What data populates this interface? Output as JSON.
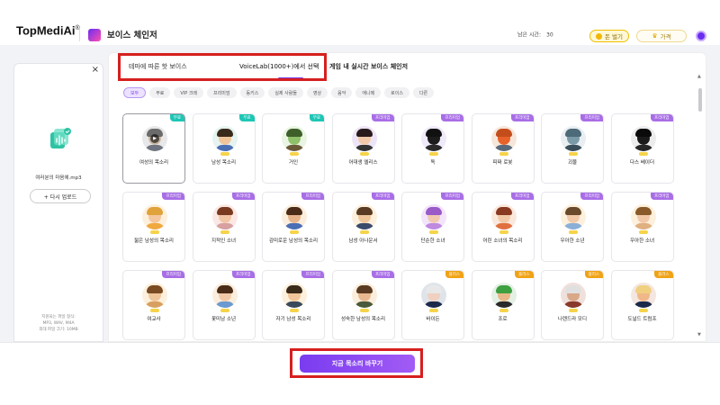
{
  "header": {
    "logo": "TopMediAi",
    "logo_mark": "®",
    "tool_title": "보이스 체인저",
    "remaining_label": "남은 시간:",
    "remaining_value": "30",
    "earn_label": "돈 벌기",
    "price_label": "가격"
  },
  "left_panel": {
    "close": "×",
    "file_name": "여러분의 마음에.mp3",
    "reupload_label": "+ 다시 업로드",
    "note_lines": [
      "지원되는 파일 형식:",
      "MP3, WAV, M4A",
      "최대 파일 크기: 10MB"
    ]
  },
  "tabs": [
    {
      "label": "테마에 따른 핫 보이스"
    },
    {
      "label": "VoiceLab(1000+)에서 선택"
    },
    {
      "label": "게임 내 실시간 보이스 체인저"
    }
  ],
  "filters": [
    "모두",
    "무료",
    "VIP 크레",
    "프리미엄",
    "동키스",
    "실제 사람들",
    "영상",
    "음악",
    "애니메",
    "로이스",
    "다른"
  ],
  "cards": [
    {
      "label": "여성의 목소리",
      "badge": "무료",
      "badge_type": "free",
      "skin": "#c9b7a4",
      "hair": "#6b6b6b",
      "shirt": "#6f7480",
      "bg": "#e8e8ea"
    },
    {
      "label": "남성 목소리",
      "badge": "무료",
      "badge_type": "free",
      "skin": "#f0c59a",
      "hair": "#3a2a1c",
      "shirt": "#4a6fb5",
      "bg": "#e6f3f0"
    },
    {
      "label": "거인",
      "badge": "무료",
      "badge_type": "free",
      "skin": "#8fc06a",
      "hair": "#3f5f2a",
      "shirt": "#6b5a3a",
      "bg": "#e9f5e2"
    },
    {
      "label": "어대생 엘리스",
      "badge": "프리미엄",
      "badge_type": "premium",
      "skin": "#f2c8a8",
      "hair": "#2a1a1a",
      "shirt": "#333",
      "bg": "#eee4f7"
    },
    {
      "label": "독",
      "badge": "프리미엄",
      "badge_type": "premium",
      "skin": "#1c1c1c",
      "hair": "#111",
      "shirt": "#2a2a2a",
      "bg": "#f0e9f9"
    },
    {
      "label": "피짜 로봇",
      "badge": "프리미엄",
      "badge_type": "premium",
      "skin": "#e8622a",
      "hair": "#c44d1c",
      "shirt": "#5a6a7a",
      "bg": "#f6e6da"
    },
    {
      "label": "괴물",
      "badge": "프리미엄",
      "badge_type": "premium",
      "skin": "#7a9aa8",
      "hair": "#4c6a78",
      "shirt": "#3b4f5a",
      "bg": "#e8eef2"
    },
    {
      "label": "다스 베이더",
      "badge": "프리미엄",
      "badge_type": "premium",
      "skin": "#1a1a1a",
      "hair": "#0a0a0a",
      "shirt": "#262626",
      "bg": "#ececec"
    },
    {
      "label": "젊은 남성의 목소리",
      "badge": "프리미엄",
      "badge_type": "premium",
      "skin": "#f4c79f",
      "hair": "#e0a23a",
      "shirt": "#f0a840",
      "bg": "#fdf0dc"
    },
    {
      "label": "지적인 소녀",
      "badge": "프리미엄",
      "badge_type": "premium",
      "skin": "#f2c5a5",
      "hair": "#7a3a20",
      "shirt": "#d8a0a0",
      "bg": "#fbe8e4"
    },
    {
      "label": "감미로운 남성의 목소리",
      "badge": "프리미엄",
      "badge_type": "premium",
      "skin": "#e7b48c",
      "hair": "#4a2c18",
      "shirt": "#4a6fb5",
      "bg": "#fbeedd"
    },
    {
      "label": "남성 아나운서",
      "badge": "프리미엄",
      "badge_type": "premium",
      "skin": "#f0c59a",
      "hair": "#5a3a22",
      "shirt": "#3a4a6a",
      "bg": "#fdf0dc"
    },
    {
      "label": "단순한 소녀",
      "badge": "프리미엄",
      "badge_type": "premium",
      "skin": "#f2c9b0",
      "hair": "#9a5ac8",
      "shirt": "#c08ae0",
      "bg": "#f2e4fb"
    },
    {
      "label": "어린 소녀의 목소리",
      "badge": "프리미엄",
      "badge_type": "premium",
      "skin": "#f2c9a8",
      "hair": "#8a3a22",
      "shirt": "#e07040",
      "bg": "#fbe8dc"
    },
    {
      "label": "우아한 소년",
      "badge": "프리미엄",
      "badge_type": "premium",
      "skin": "#f2c9a8",
      "hair": "#6a4a2a",
      "shirt": "#8ab0d8",
      "bg": "#fdf0dc"
    },
    {
      "label": "우아한 소녀",
      "badge": "프리미엄",
      "badge_type": "premium",
      "skin": "#f2c9a8",
      "hair": "#8a5a2a",
      "shirt": "#e0b080",
      "bg": "#fdf0dc"
    },
    {
      "label": "여교사",
      "badge": "프리미엄",
      "badge_type": "premium",
      "skin": "#f0c59a",
      "hair": "#7a4a22",
      "shirt": "#d8a060",
      "bg": "#fdf0dc"
    },
    {
      "label": "꽃미남 소년",
      "badge": "프리미엄",
      "badge_type": "premium",
      "skin": "#f2c9a8",
      "hair": "#4a2c18",
      "shirt": "#6a9ad0",
      "bg": "#fbeedd"
    },
    {
      "label": "자기 남성 목소리",
      "badge": "프리미엄",
      "badge_type": "premium",
      "skin": "#f0c59a",
      "hair": "#3a2a1a",
      "shirt": "#3a4a5a",
      "bg": "#fdf0dc"
    },
    {
      "label": "성숙한 남성의 목소리",
      "badge": "프리미엄",
      "badge_type": "premium",
      "skin": "#e8b890",
      "hair": "#5a3a22",
      "shirt": "#4a5a3a",
      "bg": "#fbeedd"
    },
    {
      "label": "바이든",
      "badge": "플러스",
      "badge_type": "plus",
      "skin": "#f0d0c0",
      "hair": "#e8e8e8",
      "shirt": "#1c2a4a",
      "bg": "#dfe4ea"
    },
    {
      "label": "조로",
      "badge": "플러스",
      "badge_type": "plus",
      "skin": "#e8b888",
      "hair": "#3ea040",
      "shirt": "#2a2a2a",
      "bg": "#e4f0e4"
    },
    {
      "label": "나렌드라 모디",
      "badge": "플러스",
      "badge_type": "plus",
      "skin": "#d8a888",
      "hair": "#e0e0e0",
      "shirt": "#8a3a2a",
      "bg": "#f0e0dc"
    },
    {
      "label": "도널드 트럼프",
      "badge": "플러스",
      "badge_type": "plus",
      "skin": "#f0b888",
      "hair": "#f0d080",
      "shirt": "#1c2a4a",
      "bg": "#f4e6e0"
    }
  ],
  "action": {
    "change_label": "지금 목소리 바꾸기"
  }
}
